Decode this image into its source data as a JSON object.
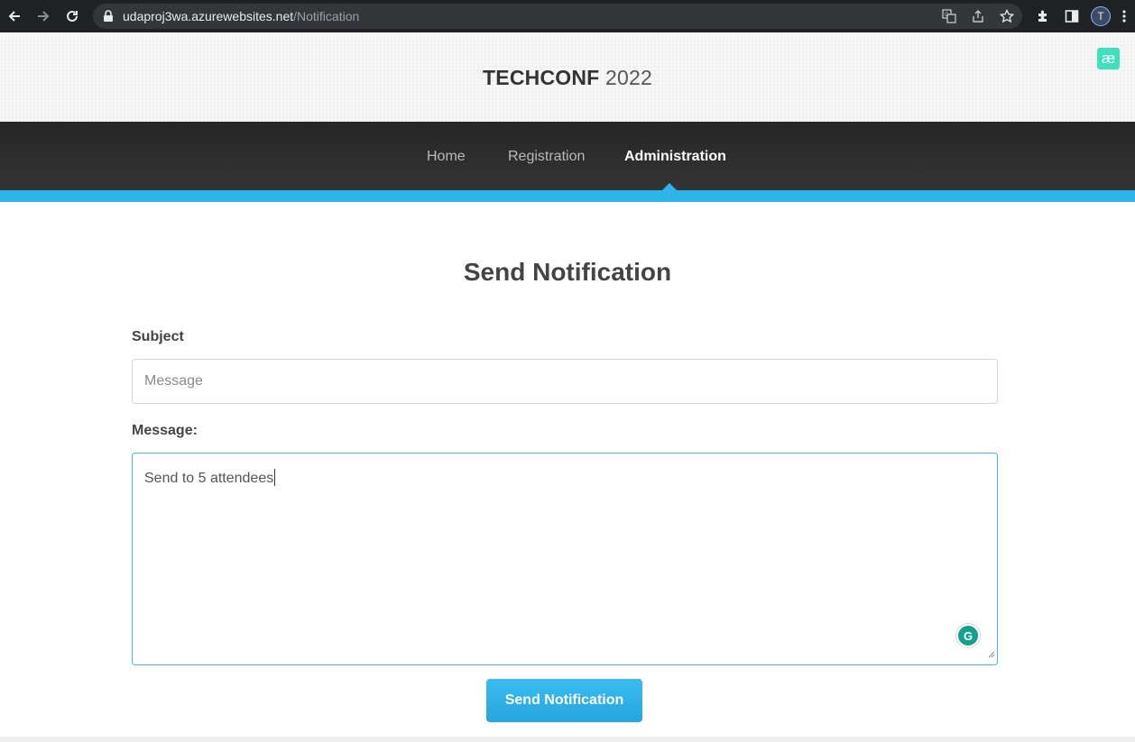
{
  "browser": {
    "url_host": "udaproj3wa.azurewebsites.net",
    "url_path": "/Notification",
    "profile_initial": "T"
  },
  "site": {
    "brand_strong": "TECHCONF",
    "brand_year": " 2022",
    "extension_badge": "æ"
  },
  "nav": {
    "items": [
      {
        "label": "Home"
      },
      {
        "label": "Registration"
      },
      {
        "label": "Administration",
        "active": true
      }
    ]
  },
  "form": {
    "title": "Send Notification",
    "subject_label": "Subject",
    "subject_placeholder": "Message",
    "subject_value": "",
    "message_label": "Message:",
    "message_value": "Send to 5 attendees",
    "submit_label": "Send Notification"
  },
  "colors": {
    "accent": "#2eb4ec",
    "navbar": "#2d2d2d",
    "grammarly": "#15a08e"
  },
  "icons": [
    "back-arrow-icon",
    "forward-arrow-icon",
    "reload-icon",
    "lock-icon",
    "translate-icon",
    "share-icon",
    "star-icon",
    "extensions-icon",
    "sidepanel-icon",
    "more-icon",
    "grammarly-icon"
  ]
}
